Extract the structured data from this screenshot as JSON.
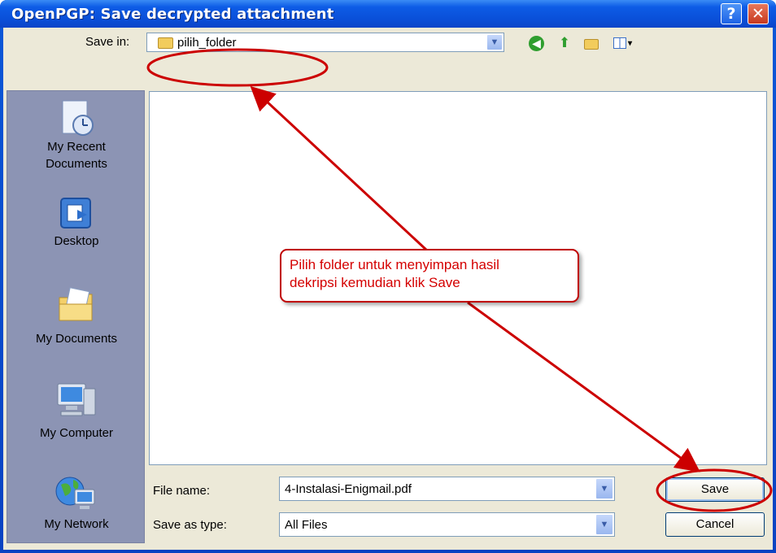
{
  "window": {
    "title": "OpenPGP: Save decrypted attachment",
    "help_glyph": "?",
    "close_glyph": "✕"
  },
  "toolbar": {
    "save_in_label": "Save in:",
    "save_in_value": "pilih_folder",
    "back_icon": "back-icon",
    "up_icon": "up-folder-icon",
    "new_folder_icon": "new-folder-icon",
    "views_icon": "views-menu-icon"
  },
  "places": [
    {
      "label": "My Recent Documents",
      "line1": "My Recent",
      "line2": "Documents",
      "icon": "recent-documents-icon"
    },
    {
      "label": "Desktop",
      "icon": "desktop-icon"
    },
    {
      "label": "My Documents",
      "icon": "my-documents-icon"
    },
    {
      "label": "My Computer",
      "icon": "my-computer-icon"
    },
    {
      "label": "My Network",
      "icon": "my-network-icon"
    }
  ],
  "form": {
    "file_name_label": "File name:",
    "file_name_value": "4-Instalasi-Enigmail.pdf",
    "save_as_type_label": "Save as type:",
    "save_as_type_value": "All Files"
  },
  "buttons": {
    "save": "Save",
    "cancel": "Cancel"
  },
  "annotation": {
    "line1": "Pilih folder untuk menyimpan hasil",
    "line2": "dekripsi kemudian klik Save",
    "color": "#cc0000"
  },
  "colors": {
    "title_bar": "#0a4fd8",
    "dialog_bg": "#ece9d8",
    "places_bar": "#8c94b4",
    "annotation": "#cc0000"
  }
}
